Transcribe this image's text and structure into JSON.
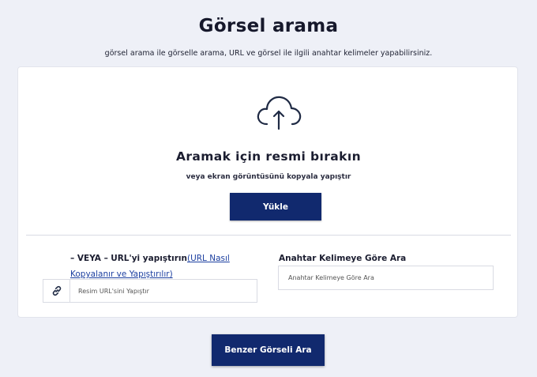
{
  "header": {
    "title": "Görsel arama",
    "subtitle": "görsel arama ile görselle arama, URL ve görsel ile ilgili anahtar kelimeler yapabilirsiniz."
  },
  "upload": {
    "icon": "cloud-upload-icon",
    "drop_text": "Aramak için resmi bırakın",
    "drop_sub": "veya ekran görüntüsünü kopyala yapıştır",
    "button_label": "Yükle"
  },
  "url_section": {
    "or_text": "– VEYA –",
    "paste_text": "URL'yi yapıştırın",
    "link_text": "(URL Nasıl Kopyalanır ve Yapıştırılır)",
    "icon": "link-icon",
    "placeholder": "Resim URL'sini Yapıştır"
  },
  "keyword_section": {
    "label": "Anahtar Kelimeye Göre Ara",
    "placeholder": "Anahtar Kelimeye Göre Ara"
  },
  "search_button": {
    "label": "Benzer Görseli Ara"
  },
  "colors": {
    "primary": "#11296e",
    "background": "#eef0f7",
    "link": "#1c3fa0"
  }
}
